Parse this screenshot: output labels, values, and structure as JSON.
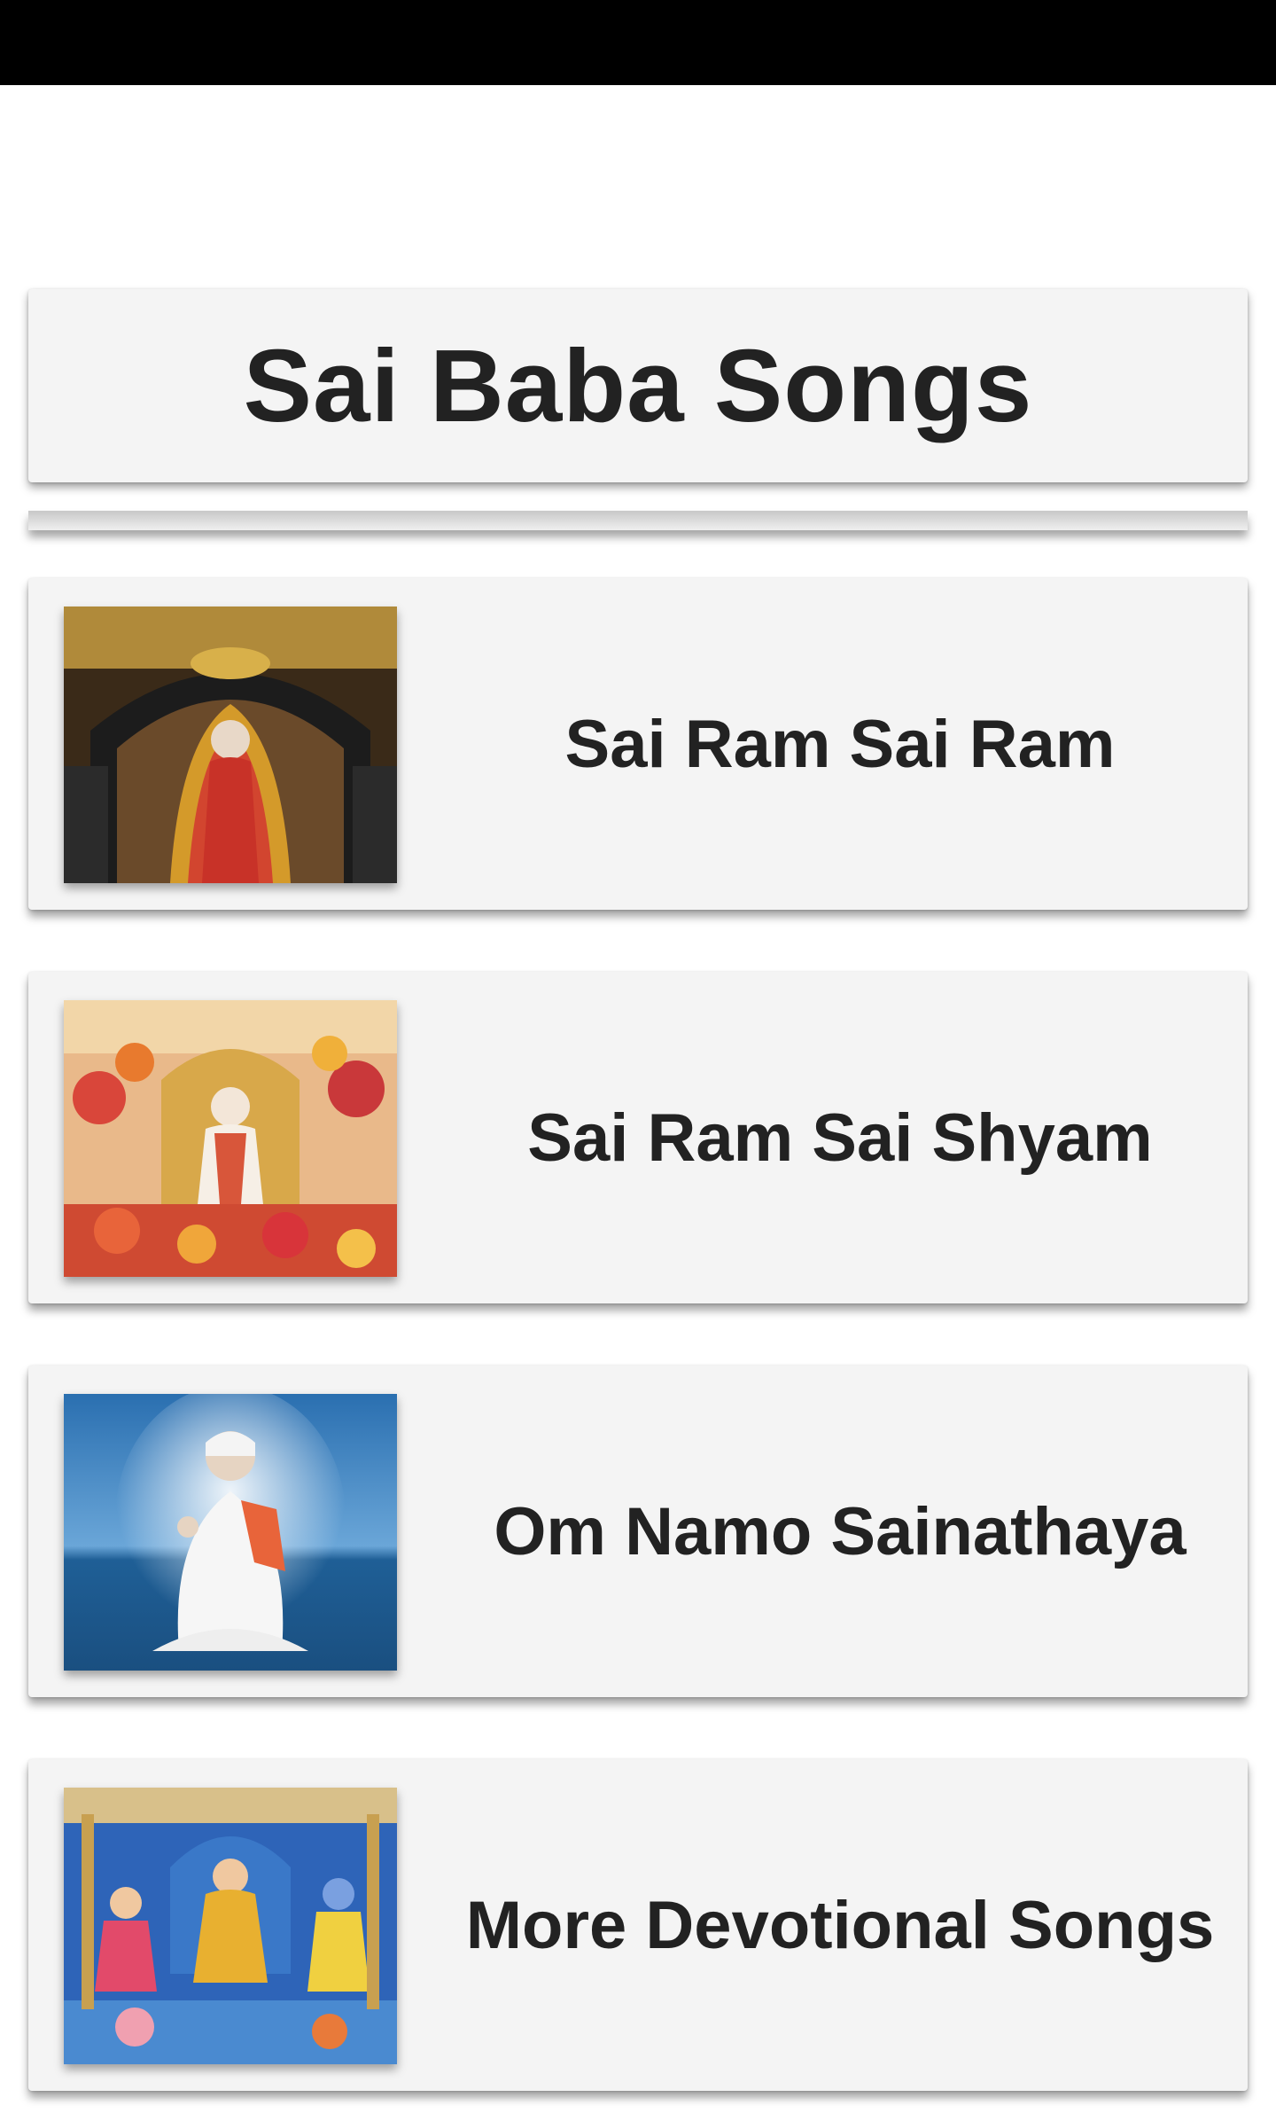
{
  "app": {
    "title": "Sai Baba Songs"
  },
  "songs": [
    {
      "label": "Sai Ram Sai Ram",
      "thumbnail_icon": "sai-baba-temple-image"
    },
    {
      "label": "Sai Ram Sai Shyam",
      "thumbnail_icon": "sai-baba-flower-shrine-image"
    },
    {
      "label": "Om Namo Sainathaya",
      "thumbnail_icon": "sai-baba-ocean-image"
    },
    {
      "label": "More Devotional Songs",
      "thumbnail_icon": "hindu-deities-image"
    }
  ],
  "colors": {
    "status_bar": "#000000",
    "card_background": "#f4f4f4",
    "text": "#222222",
    "page_background": "#ffffff"
  }
}
